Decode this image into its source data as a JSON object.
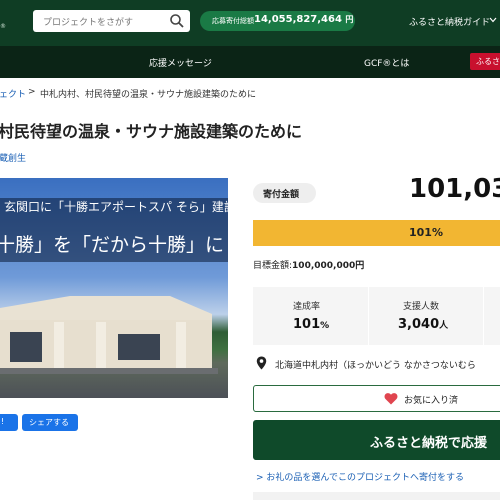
{
  "header": {
    "logo_mark": "®",
    "search_placeholder": "プロジェクトをさがす",
    "total_label": "応募寄付総額",
    "total_value": "14,055,827,464",
    "total_unit": "円",
    "guide_label": "ふるさと納税ガイド"
  },
  "nav": {
    "items": [
      "応援メッセージ",
      "GCF®とは"
    ],
    "red_button": "ふるさ"
  },
  "breadcrumb": {
    "link": "ェクト",
    "separator": ">",
    "current": "中札内村、村民待望の温泉・サウナ施設建築のために"
  },
  "project": {
    "title": "村民待望の温泉・サウナ施設建築のために",
    "organizer": "蔵創生"
  },
  "hero": {
    "line1": "玄関口に「十勝エアポートスパ そら」建設!",
    "line2": "十勝」を「だから十勝」に"
  },
  "share": {
    "first": "!",
    "second": "シェアする"
  },
  "funding": {
    "badge": "寄付金額",
    "amount": "101,03",
    "progress_label": "101%",
    "progress_fraction": 1.0,
    "target_label": "目標金額:",
    "target_value": "100,000,000円",
    "stats": [
      {
        "label": "達成率",
        "value": "101",
        "unit": "%"
      },
      {
        "label": "支援人数",
        "value": "3,040",
        "unit": "人"
      }
    ],
    "location": "北海道中札内村（ほっかいどう なかさつないむら"
  },
  "actions": {
    "favorite": "お気に入り済",
    "donate": "ふるさと納税で応援",
    "gift_link": "お礼の品を選んでこのプロジェクトへ寄付をする"
  },
  "colors": {
    "header_bg": "#0f3d24",
    "nav_bg": "#0b2416",
    "progress": "#f2b632",
    "donate_bg": "#0f4a2a",
    "link": "#1a5fb4",
    "share_btn": "#1a73e8",
    "heart": "#e0454f"
  }
}
